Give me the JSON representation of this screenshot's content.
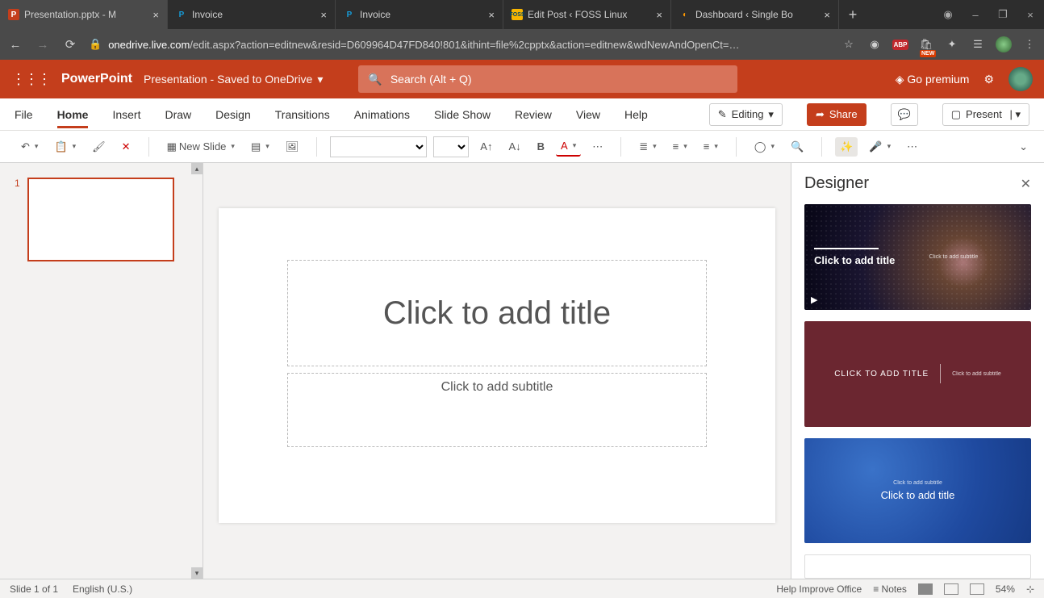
{
  "tabs": [
    {
      "label": "Presentation.pptx - M",
      "icon": "P",
      "icon_bg": "#c43e1c",
      "active": true
    },
    {
      "label": "Invoice",
      "icon": "P",
      "icon_bg": "#003087",
      "active": false
    },
    {
      "label": "Invoice",
      "icon": "P",
      "icon_bg": "#003087",
      "active": false
    },
    {
      "label": "Edit Post ‹ FOSS Linux",
      "icon": "▦",
      "icon_bg": "#f7b500",
      "active": false
    },
    {
      "label": "Dashboard ‹ Single Bo",
      "icon": "◐",
      "icon_bg": "#ff9800",
      "active": false
    }
  ],
  "url": {
    "host": "onedrive.live.com",
    "path": "/edit.aspx?action=editnew&resid=D609964D47FD840!801&ithint=file%2cpptx&action=editnew&wdNewAndOpenCt=…"
  },
  "ext_new": "NEW",
  "app": {
    "name": "PowerPoint",
    "doc": "Presentation  -  Saved to OneDrive",
    "search": "Search (Alt + Q)",
    "premium": "Go premium"
  },
  "ribbon": {
    "tabs": [
      "File",
      "Home",
      "Insert",
      "Draw",
      "Design",
      "Transitions",
      "Animations",
      "Slide Show",
      "Review",
      "View",
      "Help"
    ],
    "active": "Home",
    "editing": "Editing",
    "share": "Share",
    "present": "Present"
  },
  "toolbar": {
    "newslide": "New Slide"
  },
  "thumb": {
    "num": "1"
  },
  "slide": {
    "title": "Click to add title",
    "sub": "Click to add subtitle"
  },
  "designer": {
    "title": "Designer",
    "cards": [
      {
        "t": "Click to add title",
        "s": "Click to add subtitle"
      },
      {
        "t": "CLICK TO ADD TITLE",
        "s": "Click to add subtitle"
      },
      {
        "t": "Click to add title",
        "s": "Click to add subtitle"
      }
    ]
  },
  "status": {
    "slide": "Slide 1 of 1",
    "lang": "English (U.S.)",
    "help": "Help Improve Office",
    "notes": "Notes",
    "zoom": "54%"
  }
}
